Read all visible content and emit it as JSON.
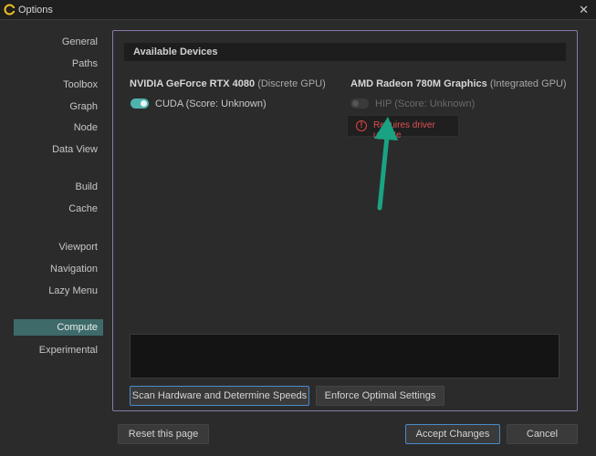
{
  "window": {
    "title": "Options",
    "close_glyph": "✕"
  },
  "sidebar": {
    "items": [
      {
        "label": "General"
      },
      {
        "label": "Paths"
      },
      {
        "label": "Toolbox"
      },
      {
        "label": "Graph"
      },
      {
        "label": "Node"
      },
      {
        "label": "Data View"
      },
      {
        "label": "Build"
      },
      {
        "label": "Cache"
      },
      {
        "label": "Viewport"
      },
      {
        "label": "Navigation"
      },
      {
        "label": "Lazy Menu"
      },
      {
        "label": "Compute",
        "active": true
      },
      {
        "label": "Experimental"
      }
    ]
  },
  "main": {
    "section_title": "Available Devices",
    "devices": [
      {
        "name": "NVIDIA GeForce RTX 4080",
        "type": "(Discrete GPU)",
        "backend": "CUDA (Score: Unknown)",
        "enabled": true
      },
      {
        "name": "AMD Radeon 780M Graphics",
        "type": "(Integrated GPU)",
        "backend": "HIP (Score: Unknown)",
        "enabled": false,
        "warning": "Requires driver update"
      }
    ],
    "scan_button": "Scan Hardware and Determine Speeds",
    "enforce_button": "Enforce Optimal Settings"
  },
  "footer": {
    "reset_button": "Reset this page",
    "accept_button": "Accept Changes",
    "cancel_button": "Cancel"
  },
  "colors": {
    "accent": "#4fb3ad",
    "warning": "#e05050",
    "annotation_arrow": "#1aa383",
    "frame_border": "#8a7aa8"
  }
}
